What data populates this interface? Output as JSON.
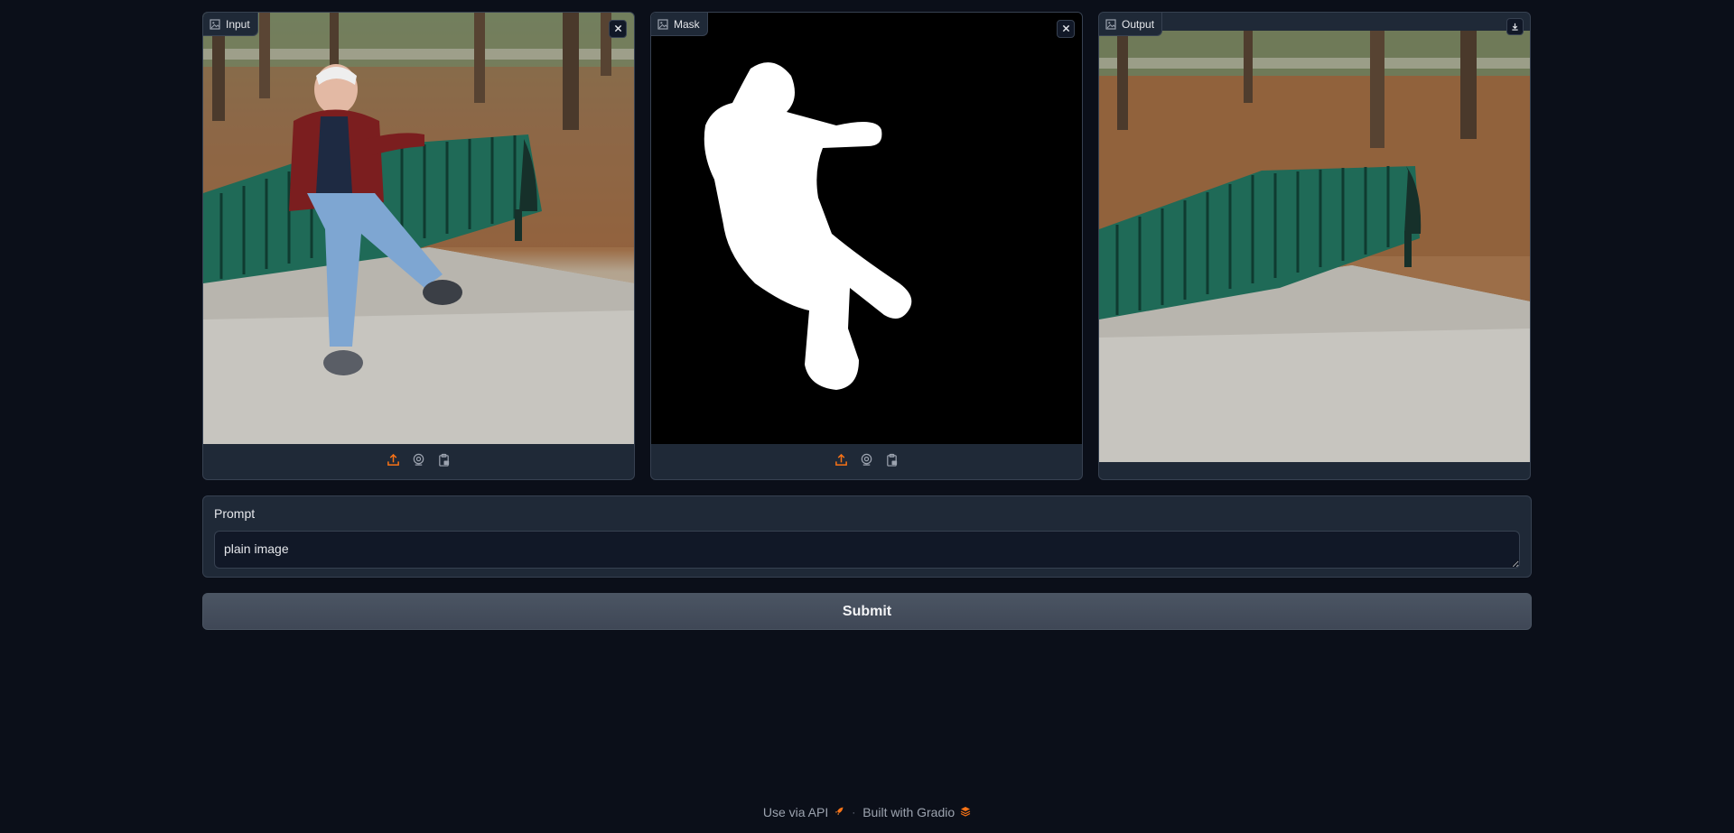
{
  "panels": {
    "input": {
      "label": "Input",
      "label_icon": "image-icon",
      "close_icon": "close-icon",
      "toolbar": [
        "upload-icon",
        "webcam-icon",
        "clipboard-icon"
      ]
    },
    "mask": {
      "label": "Mask",
      "label_icon": "image-icon",
      "close_icon": "close-icon",
      "toolbar": [
        "upload-icon",
        "webcam-icon",
        "clipboard-icon"
      ]
    },
    "output": {
      "label": "Output",
      "label_icon": "image-icon",
      "download_icon": "download-icon"
    }
  },
  "prompt": {
    "label": "Prompt",
    "value": "plain image"
  },
  "submit": {
    "label": "Submit"
  },
  "footer": {
    "api_label": "Use via API",
    "api_icon": "rocket-icon",
    "separator": "·",
    "built_label": "Built with Gradio",
    "built_icon": "gradio-logo-icon"
  },
  "colors": {
    "background": "#0b0f19",
    "panel": "#1f2937",
    "border": "#374151",
    "accent_orange": "#f97316",
    "submit_bg": "#4b5563"
  }
}
